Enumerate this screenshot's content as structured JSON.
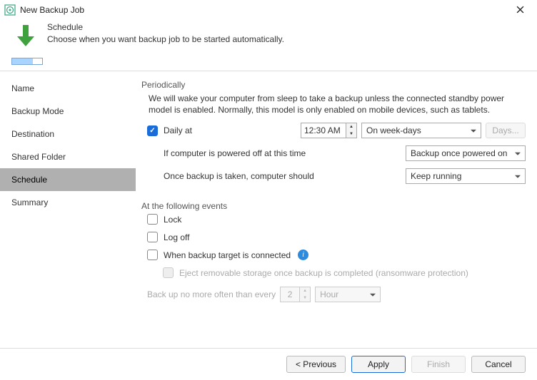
{
  "window": {
    "title": "New Backup Job"
  },
  "header": {
    "heading": "Schedule",
    "subtitle": "Choose when you want backup job to be started automatically."
  },
  "sidebar": {
    "items": [
      {
        "label": "Name"
      },
      {
        "label": "Backup Mode"
      },
      {
        "label": "Destination"
      },
      {
        "label": "Shared Folder"
      },
      {
        "label": "Schedule"
      },
      {
        "label": "Summary"
      }
    ],
    "active_index": 4
  },
  "periodic": {
    "section_title": "Periodically",
    "help_text": "We will wake your computer from sleep to take a backup unless the connected standby power model is enabled. Normally, this model is only enabled on mobile devices, such as tablets.",
    "daily_label": "Daily at",
    "time_value": "12:30 AM",
    "weekday_value": "On week-days",
    "days_button": "Days...",
    "powered_off_label": "If computer is powered off at this time",
    "powered_off_value": "Backup once powered on",
    "after_backup_label": "Once backup is taken, computer should",
    "after_backup_value": "Keep running"
  },
  "events": {
    "section_title": "At the following events",
    "lock": "Lock",
    "logoff": "Log off",
    "target_connected": "When backup target is connected",
    "eject": "Eject removable storage once backup is completed (ransomware protection)",
    "freq_label": "Back up no more often than every",
    "freq_value": "2",
    "freq_unit": "Hour"
  },
  "footer": {
    "previous": "< Previous",
    "apply": "Apply",
    "finish": "Finish",
    "cancel": "Cancel"
  }
}
